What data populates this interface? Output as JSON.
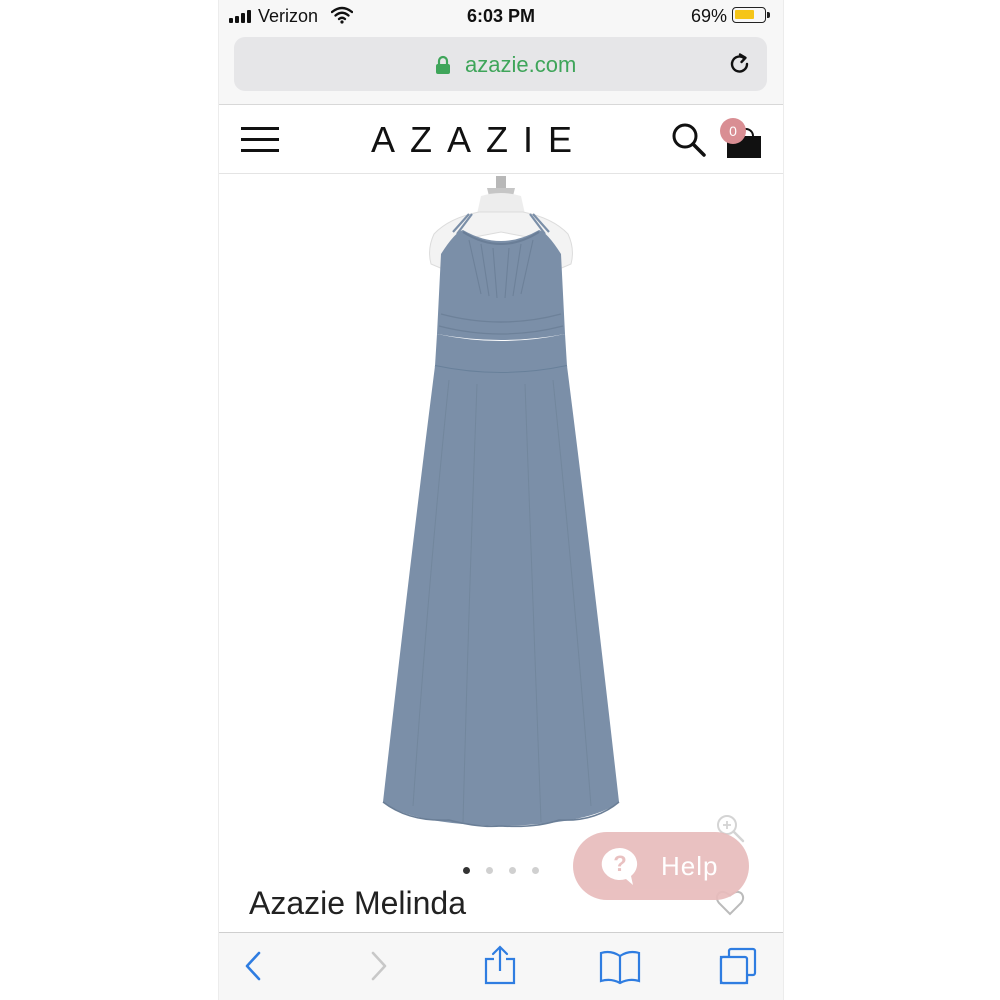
{
  "status_bar": {
    "carrier": "Verizon",
    "time": "6:03 PM",
    "battery_percent": "69%",
    "battery_level": 0.69
  },
  "browser": {
    "url": "azazie.com"
  },
  "site": {
    "logo": "AZAZIE",
    "cart_count": "0"
  },
  "product": {
    "name": "Azazie Melinda",
    "dress_color": "#7b8fa8",
    "image_count": 4,
    "active_image": 1
  },
  "help": {
    "label": "Help",
    "color": "#e8bcbc"
  },
  "colors": {
    "accent_green": "#3fa55a",
    "ios_blue": "#2f7de1",
    "badge": "#d98e93"
  }
}
